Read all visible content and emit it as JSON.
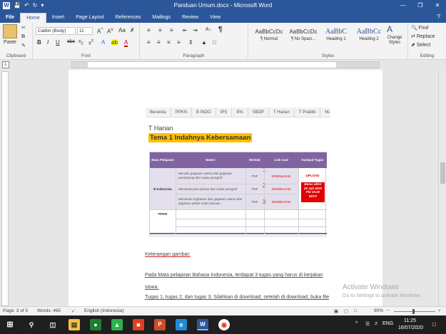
{
  "window": {
    "title": "Panduan Umum.docx  -  Microsoft Word"
  },
  "ribbon_tabs": [
    "File",
    "Home",
    "Insert",
    "Page Layout",
    "References",
    "Mailings",
    "Review",
    "View"
  ],
  "clipboard": {
    "paste": "Paste",
    "label": "Clipboard"
  },
  "font": {
    "name": "Calibri (Body)",
    "size": "11",
    "label": "Font"
  },
  "paragraph": {
    "label": "Paragraph"
  },
  "styles": {
    "label": "Styles",
    "items": [
      {
        "preview": "AaBbCcDc",
        "name": "¶ Normal"
      },
      {
        "preview": "AaBbCcDc",
        "name": "¶ No Spaci..."
      },
      {
        "preview": "AaBbC",
        "name": "Heading 1"
      },
      {
        "preview": "AaBbCc",
        "name": "Heading 2"
      }
    ],
    "change": "Change Styles"
  },
  "editing": {
    "find": "Find",
    "replace": "Replace",
    "select": "Select",
    "label": "Editing"
  },
  "doc": {
    "nav_items": [
      "Beranda",
      "PPKN",
      "B INDO",
      "IPS",
      "IPA",
      "SBDP",
      "T Harian",
      "T Praktik",
      "Ma"
    ],
    "subheading": "T Harian",
    "heading": "Tema 1 Indahnya Kebersamaan",
    "table": {
      "headers": [
        "Mata Pelajaran",
        "Materi",
        "Bentuk",
        "Link soal",
        "Kumpul Tugas"
      ],
      "subject1": "B Indonesia",
      "subject2": "PPKN",
      "rows": [
        {
          "materi": "Menulis gagasan utama dan gagasan pendukung dari suatu paragraf",
          "bentuk": "PDF",
          "link": "DOWNLOAD",
          "num": "1",
          "kumpul": "UPLOAD"
        },
        {
          "materi": "Membuat peta pikiran dari suatu paragraf",
          "bentuk": "PDF",
          "link": "DOWNLOAD",
          "num": "2"
        },
        {
          "materi": "Membuat ringkasan dari gagasan utama dan gagasan pokok suatu bacaan",
          "bentuk": "PDF",
          "link": "DOWNLOAD",
          "num": "3"
        }
      ],
      "deadline": [
        "Batas akhir",
        "25 Juli 2020",
        "Pkl 23.00",
        "WITA"
      ]
    },
    "caption": "Keterangan gambar:",
    "para1": "Pada Mata pelajaran Bahasa Indonesia, terdapat 3 tugas yang harus di kerjakan",
    "para1b": "siswa.",
    "para2": "Tugas 1, tugas 2, dan tugas 3. Silahkan di download, setelah di download, buka file"
  },
  "watermark": {
    "line1": "Activate Windows",
    "line2": "Go to Settings to activate Windows."
  },
  "status": {
    "page": "Page: 3 of 5",
    "words": "Words: 465",
    "lang": "English (Indonesia)",
    "zoom": "90%"
  },
  "taskbar": {
    "lang": "ENG",
    "time": "11:25",
    "date": "16/07/2020"
  }
}
